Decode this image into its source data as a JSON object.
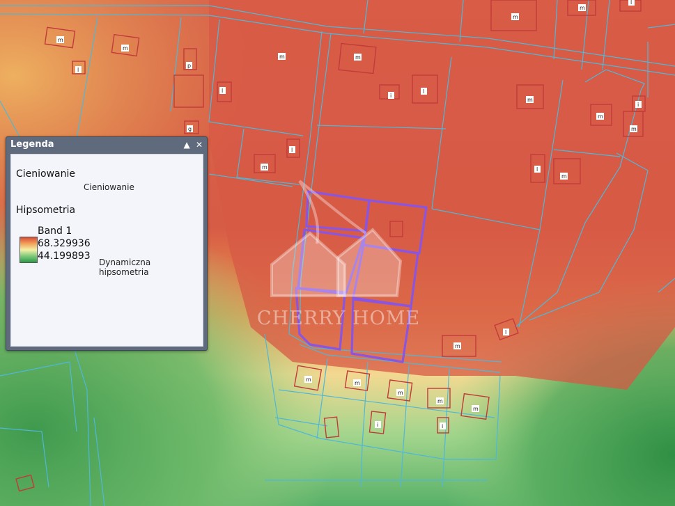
{
  "legend": {
    "title": "Legenda",
    "collapse_icon": "▲",
    "close_icon": "✕",
    "layer1_name": "Cieniowanie",
    "layer1_item": "Cieniowanie",
    "layer2_name": "Hipsometria",
    "band_label": "Band 1",
    "max_value": "68.329936",
    "min_value": "44.199893",
    "ramp_label": "Dynamiczna hipsometria",
    "ramp_colors": [
      "#d84b3a",
      "#f1a25a",
      "#f4f0a6",
      "#7ec97b",
      "#2e9a48"
    ]
  },
  "watermark": {
    "text": "CHERRY HOME"
  },
  "map": {
    "building_labels": [
      "m",
      "m",
      "l",
      "p",
      "l",
      "m",
      "g",
      "l",
      "m",
      "m",
      "i",
      "l",
      "m",
      "m",
      "l",
      "m",
      "m",
      "i",
      "m",
      "l",
      "m",
      "m",
      "m",
      "m",
      "m",
      "m",
      "i",
      "l",
      "m",
      "i"
    ],
    "selection_color": "#8a55e0",
    "parcel_color": "#4fb7d8",
    "building_color": "#c23a3a"
  }
}
